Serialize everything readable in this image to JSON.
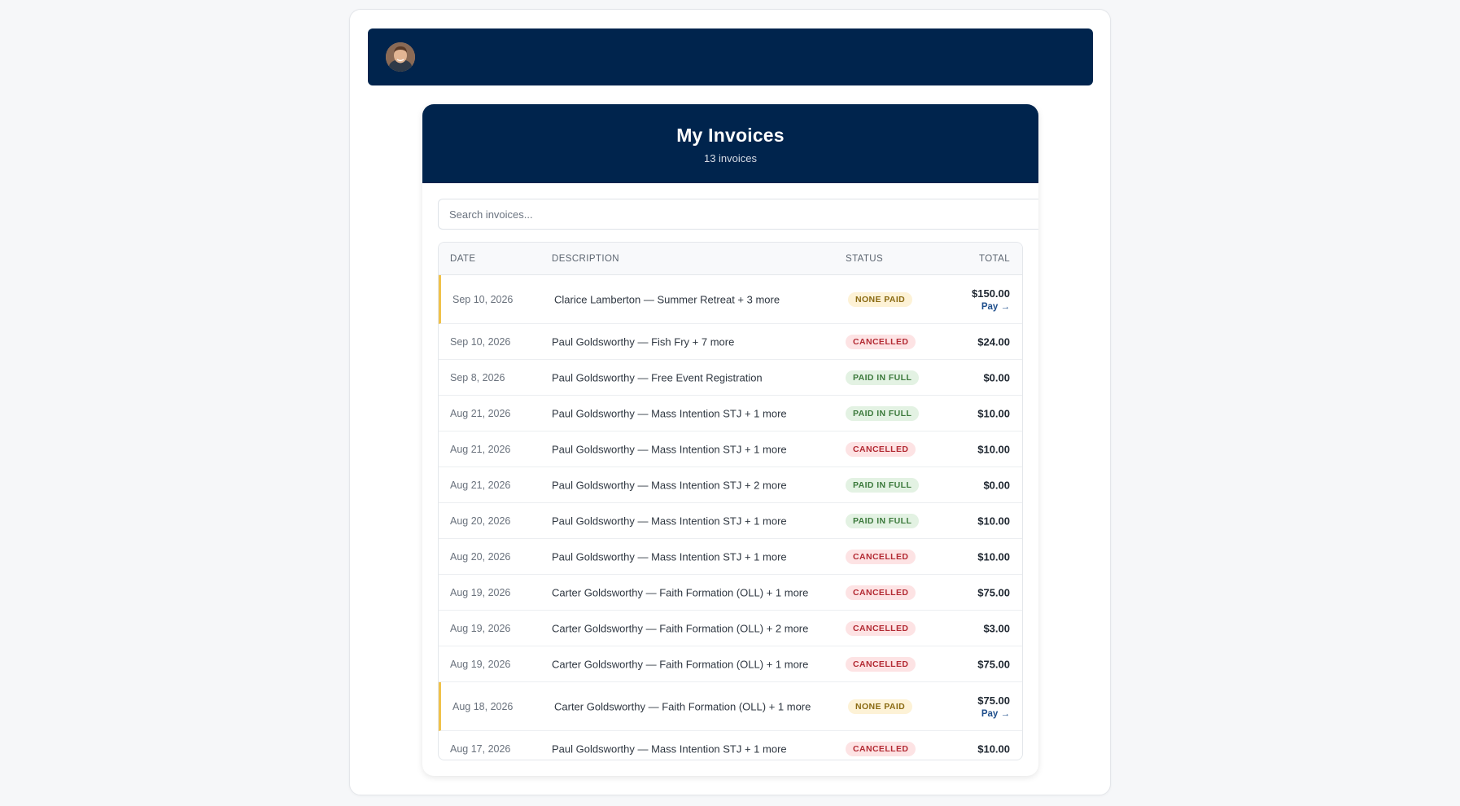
{
  "header": {
    "avatar_alt": "User avatar"
  },
  "page": {
    "title": "My Invoices",
    "subtitle": "13 invoices"
  },
  "search": {
    "placeholder": "Search invoices..."
  },
  "table": {
    "columns": [
      "DATE",
      "DESCRIPTION",
      "STATUS",
      "TOTAL"
    ],
    "pay_label": "Pay →",
    "rows": [
      {
        "date": "Sep 10, 2026",
        "description": "Clarice Lamberton — Summer Retreat + 3 more",
        "status": "NONE PAID",
        "total": "$150.00"
      },
      {
        "date": "Sep 10, 2026",
        "description": "Paul Goldsworthy — Fish Fry + 7 more",
        "status": "CANCELLED",
        "total": "$24.00"
      },
      {
        "date": "Sep 8, 2026",
        "description": "Paul Goldsworthy — Free Event Registration",
        "status": "PAID IN FULL",
        "total": "$0.00"
      },
      {
        "date": "Aug 21, 2026",
        "description": "Paul Goldsworthy — Mass Intention STJ + 1 more",
        "status": "PAID IN FULL",
        "total": "$10.00"
      },
      {
        "date": "Aug 21, 2026",
        "description": "Paul Goldsworthy — Mass Intention STJ + 1 more",
        "status": "CANCELLED",
        "total": "$10.00"
      },
      {
        "date": "Aug 21, 2026",
        "description": "Paul Goldsworthy — Mass Intention STJ + 2 more",
        "status": "PAID IN FULL",
        "total": "$0.00"
      },
      {
        "date": "Aug 20, 2026",
        "description": "Paul Goldsworthy — Mass Intention STJ + 1 more",
        "status": "PAID IN FULL",
        "total": "$10.00"
      },
      {
        "date": "Aug 20, 2026",
        "description": "Paul Goldsworthy — Mass Intention STJ + 1 more",
        "status": "CANCELLED",
        "total": "$10.00"
      },
      {
        "date": "Aug 19, 2026",
        "description": "Carter Goldsworthy — Faith Formation (OLL) + 1 more",
        "status": "CANCELLED",
        "total": "$75.00"
      },
      {
        "date": "Aug 19, 2026",
        "description": "Carter Goldsworthy — Faith Formation (OLL) + 2 more",
        "status": "CANCELLED",
        "total": "$3.00"
      },
      {
        "date": "Aug 19, 2026",
        "description": "Carter Goldsworthy — Faith Formation (OLL) + 1 more",
        "status": "CANCELLED",
        "total": "$75.00"
      },
      {
        "date": "Aug 18, 2026",
        "description": "Carter Goldsworthy — Faith Formation (OLL) + 1 more",
        "status": "NONE PAID",
        "total": "$75.00"
      },
      {
        "date": "Aug 17, 2026",
        "description": "Paul Goldsworthy — Mass Intention STJ + 1 more",
        "status": "CANCELLED",
        "total": "$10.00"
      }
    ]
  },
  "colors": {
    "navy": "#00244d",
    "pending_accent": "#f0c24b",
    "none_paid": "#8a6a12",
    "cancelled": "#b32a33",
    "paid_in_full": "#3c7a3c"
  }
}
